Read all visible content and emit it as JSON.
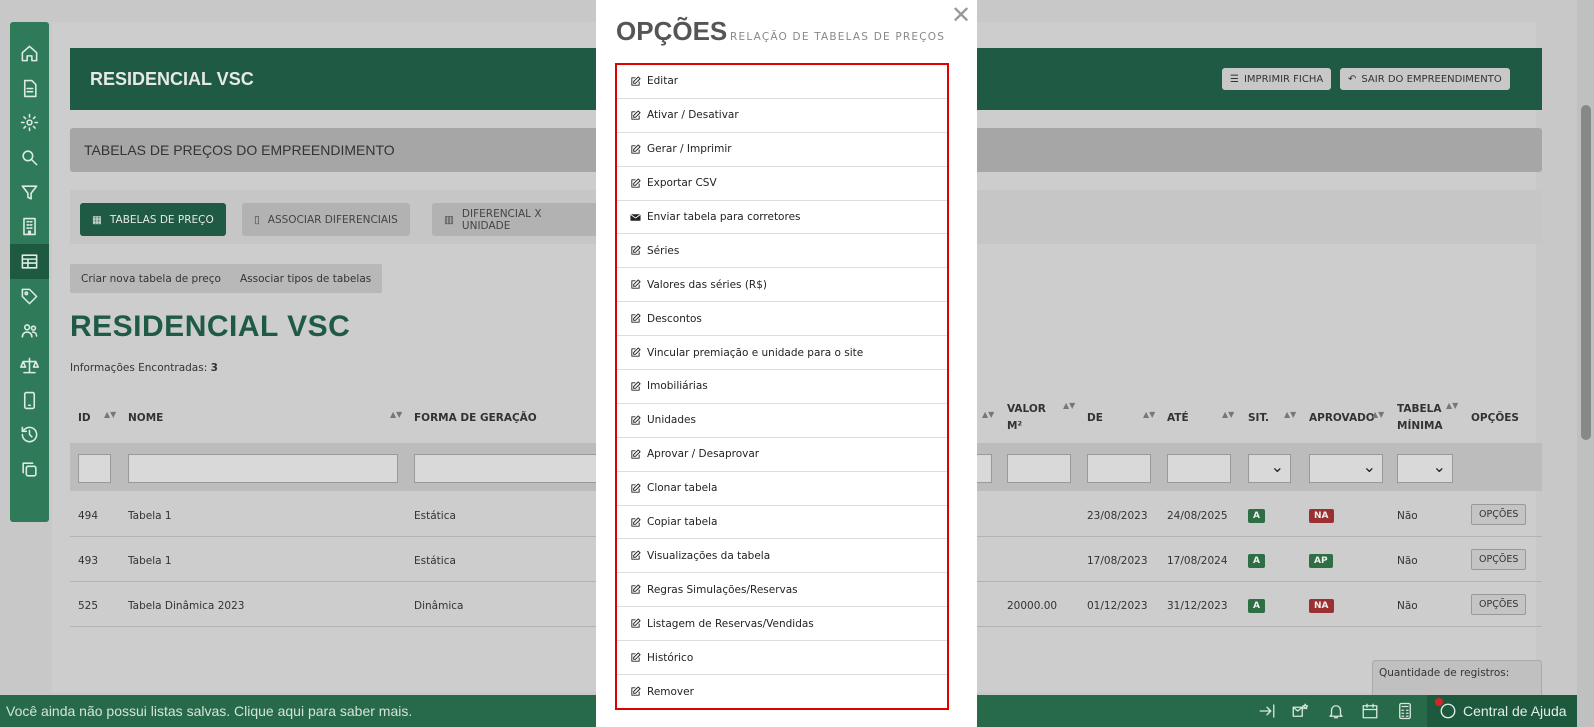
{
  "sidebar": {
    "items": [
      {
        "icon": "home-icon"
      },
      {
        "icon": "document-icon"
      },
      {
        "icon": "gear-icon"
      },
      {
        "icon": "search-icon"
      },
      {
        "icon": "filter-icon"
      },
      {
        "icon": "building-icon"
      },
      {
        "icon": "table-icon",
        "active": true
      },
      {
        "icon": "tag-icon"
      },
      {
        "icon": "users-icon"
      },
      {
        "icon": "scale-icon"
      },
      {
        "icon": "mobile-icon"
      },
      {
        "icon": "history-icon"
      },
      {
        "icon": "copy-icon"
      }
    ]
  },
  "header": {
    "title": "RESIDENCIAL VSC",
    "print_label": "IMPRIMIR FICHA",
    "exit_label": "SAIR DO EMPREENDIMENTO"
  },
  "subheader": {
    "title": "TABELAS DE PREÇOS DO EMPREENDIMENTO"
  },
  "tabs": [
    {
      "label": "TABELAS DE PREÇO",
      "active": true
    },
    {
      "label": "ASSOCIAR DIFERENCIAIS"
    },
    {
      "label": "DIFERENCIAL X UNIDADE"
    }
  ],
  "actions": {
    "new_table": "Criar nova tabela de preço",
    "assoc_types": "Associar tipos de tabelas"
  },
  "page_title": "RESIDENCIAL VSC",
  "info": {
    "label": "Informações Encontradas:",
    "count": "3"
  },
  "table": {
    "headers": {
      "id": "ID",
      "nome": "NOME",
      "forma": "FORMA DE GERAÇÃO",
      "valor_m2_1": "VALOR",
      "valor_m2_2": "M²",
      "de": "DE",
      "ate": "ATÉ",
      "sit": "SIT.",
      "aprovado": "APROVADO",
      "tabela_minima_1": "TABELA",
      "tabela_minima_2": "MÍNIMA",
      "opcoes": "OPÇÕES"
    },
    "rows": [
      {
        "id": "494",
        "nome": "Tabela 1",
        "forma": "Estática",
        "valor_m2": "",
        "de": "23/08/2023",
        "ate": "24/08/2025",
        "sit": "A",
        "aprovado": "NA",
        "minima": "Não",
        "opcoes": "OPÇÕES"
      },
      {
        "id": "493",
        "nome": "Tabela 1",
        "forma": "Estática",
        "valor_m2": "",
        "de": "17/08/2023",
        "ate": "17/08/2024",
        "sit": "A",
        "aprovado": "AP",
        "minima": "Não",
        "opcoes": "OPÇÕES"
      },
      {
        "id": "525",
        "nome": "Tabela Dinâmica 2023",
        "forma": "Dinâmica",
        "valor_m2": "20000.00",
        "de": "01/12/2023",
        "ate": "31/12/2023",
        "sit": "A",
        "aprovado": "NA",
        "minima": "Não",
        "opcoes": "OPÇÕES"
      }
    ]
  },
  "pagination": {
    "qty_label": "Quantidade de registros:"
  },
  "bottombar": {
    "message": "Você ainda não possui listas salvas. Clique aqui para saber mais.",
    "help_label": "Central de Ajuda"
  },
  "modal": {
    "title": "OPÇÕES",
    "subtitle": "RELAÇÃO DE TABELAS DE PREÇOS",
    "items": [
      {
        "label": "Editar",
        "icon": "edit-icon"
      },
      {
        "label": "Ativar / Desativar",
        "icon": "edit-icon"
      },
      {
        "label": "Gerar / Imprimir",
        "icon": "edit-icon"
      },
      {
        "label": "Exportar CSV",
        "icon": "edit-icon"
      },
      {
        "label": "Enviar tabela para corretores",
        "icon": "envelope-icon"
      },
      {
        "label": "Séries",
        "icon": "edit-icon"
      },
      {
        "label": "Valores das séries (R$)",
        "icon": "edit-icon"
      },
      {
        "label": "Descontos",
        "icon": "edit-icon"
      },
      {
        "label": "Vincular premiação e unidade para o site",
        "icon": "edit-icon"
      },
      {
        "label": "Imobiliárias",
        "icon": "edit-icon"
      },
      {
        "label": "Unidades",
        "icon": "edit-icon"
      },
      {
        "label": "Aprovar / Desaprovar",
        "icon": "edit-icon"
      },
      {
        "label": "Clonar tabela",
        "icon": "edit-icon"
      },
      {
        "label": "Copiar tabela",
        "icon": "edit-icon"
      },
      {
        "label": "Visualizações da tabela",
        "icon": "edit-icon"
      },
      {
        "label": "Regras Simulações/Reservas",
        "icon": "edit-icon"
      },
      {
        "label": "Listagem de Reservas/Vendidas",
        "icon": "edit-icon"
      },
      {
        "label": "Histórico",
        "icon": "edit-icon"
      },
      {
        "label": "Remover",
        "icon": "edit-icon"
      }
    ]
  },
  "colors": {
    "brand_green": "#1f5a45",
    "sidebar_green": "#2e7a59",
    "highlight_red": "#e00000",
    "badge_green": "#2e6e44",
    "badge_red": "#9c2f32"
  }
}
